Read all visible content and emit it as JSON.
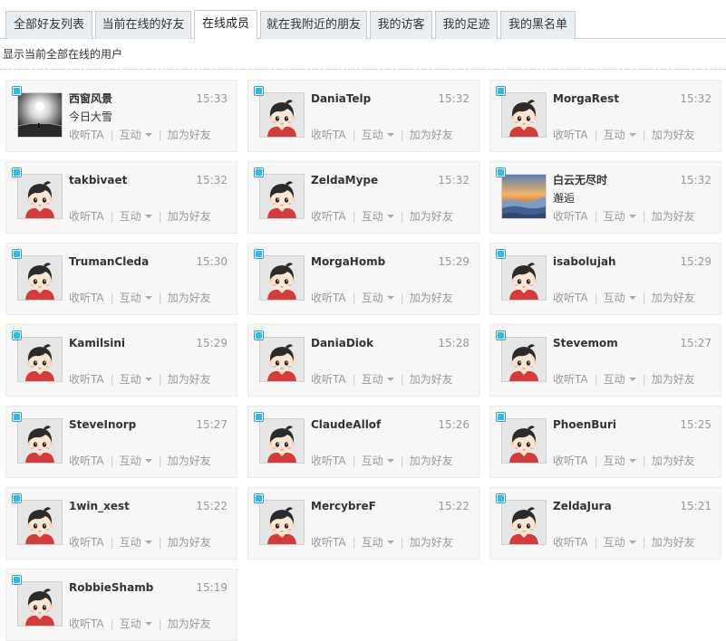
{
  "tabs": [
    {
      "label": "全部好友列表",
      "active": false
    },
    {
      "label": "当前在线的好友",
      "active": false
    },
    {
      "label": "在线成员",
      "active": true
    },
    {
      "label": "就在我附近的朋友",
      "active": false
    },
    {
      "label": "我的访客",
      "active": false
    },
    {
      "label": "我的足迹",
      "active": false
    },
    {
      "label": "我的黑名单",
      "active": false
    }
  ],
  "description": "显示当前全部在线的用户",
  "actions": {
    "follow": "收听TA",
    "interact": "互动",
    "add_friend": "加为好友",
    "separator": "|"
  },
  "colors": {
    "online_dot": "#35b9ea",
    "tab_bg": "#e9eef3",
    "card_bg": "#f7f7f7"
  },
  "users": [
    {
      "name": "西窗风景",
      "time": "15:33",
      "status": "今日大雪",
      "avatar": "landscape-sun-avatar"
    },
    {
      "name": "DaniaTelp",
      "time": "15:32",
      "status": "",
      "avatar": "default-cartoon-avatar"
    },
    {
      "name": "MorgaRest",
      "time": "15:32",
      "status": "",
      "avatar": "default-cartoon-avatar"
    },
    {
      "name": "takbivaet",
      "time": "15:32",
      "status": "",
      "avatar": "default-cartoon-avatar"
    },
    {
      "name": "ZeldaMype",
      "time": "15:32",
      "status": "",
      "avatar": "default-cartoon-avatar"
    },
    {
      "name": "白云无尽时",
      "time": "15:32",
      "status": "邂逅",
      "avatar": "sea-of-clouds-avatar"
    },
    {
      "name": "TrumanCleda",
      "time": "15:30",
      "status": "",
      "avatar": "default-cartoon-avatar"
    },
    {
      "name": "MorgaHomb",
      "time": "15:29",
      "status": "",
      "avatar": "default-cartoon-avatar"
    },
    {
      "name": "isabolujah",
      "time": "15:29",
      "status": "",
      "avatar": "default-cartoon-avatar"
    },
    {
      "name": "Kamilsini",
      "time": "15:29",
      "status": "",
      "avatar": "default-cartoon-avatar"
    },
    {
      "name": "DaniaDiok",
      "time": "15:28",
      "status": "",
      "avatar": "default-cartoon-avatar"
    },
    {
      "name": "Stevemom",
      "time": "15:27",
      "status": "",
      "avatar": "default-cartoon-avatar"
    },
    {
      "name": "SteveInorp",
      "time": "15:27",
      "status": "",
      "avatar": "default-cartoon-avatar"
    },
    {
      "name": "ClaudeAllof",
      "time": "15:26",
      "status": "",
      "avatar": "default-cartoon-avatar"
    },
    {
      "name": "PhoenBuri",
      "time": "15:25",
      "status": "",
      "avatar": "default-cartoon-avatar"
    },
    {
      "name": "1win_xest",
      "time": "15:22",
      "status": "",
      "avatar": "default-cartoon-avatar"
    },
    {
      "name": "MercybreF",
      "time": "15:22",
      "status": "",
      "avatar": "default-cartoon-avatar"
    },
    {
      "name": "ZeldaJura",
      "time": "15:21",
      "status": "",
      "avatar": "default-cartoon-avatar"
    },
    {
      "name": "RobbieShamb",
      "time": "15:19",
      "status": "",
      "avatar": "default-cartoon-avatar"
    }
  ]
}
